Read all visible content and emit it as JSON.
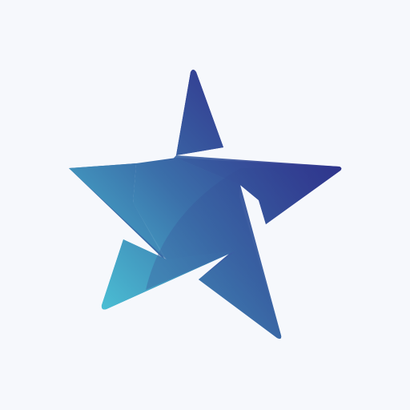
{
  "logo": {
    "icon": "star-logo-icon",
    "colors": {
      "background": "#f6f8fc",
      "gradient_light": "#4bc3d6",
      "gradient_mid": "#3b63a6",
      "gradient_dark": "#2b2f86"
    }
  }
}
